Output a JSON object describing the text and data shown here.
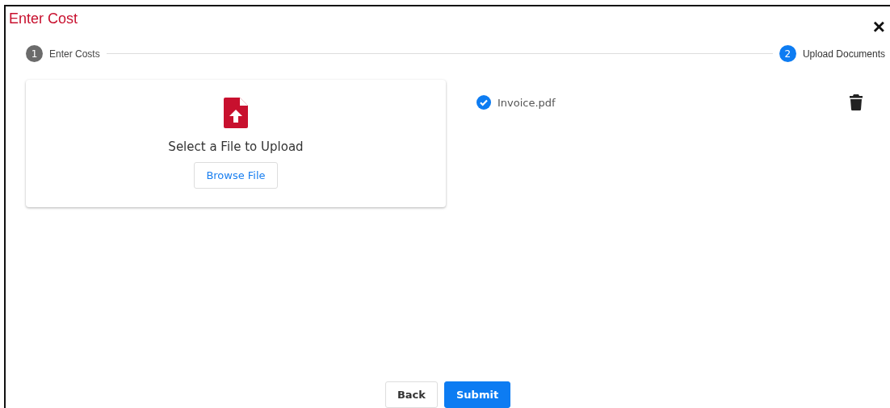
{
  "dialog": {
    "title": "Enter Cost",
    "close_label": "×"
  },
  "steps": [
    {
      "number": "1",
      "label": "Enter Costs",
      "selected": false
    },
    {
      "number": "2",
      "label": "Upload Documents",
      "selected": true
    }
  ],
  "upload": {
    "prompt": "Select a File to Upload",
    "browse": "Browse File"
  },
  "files": [
    {
      "name": "Invoice.pdf",
      "uploaded": true
    }
  ],
  "buttons": [
    {
      "label": "Back",
      "kind": "secondary"
    },
    {
      "label": "Submit",
      "kind": "primary"
    }
  ]
}
